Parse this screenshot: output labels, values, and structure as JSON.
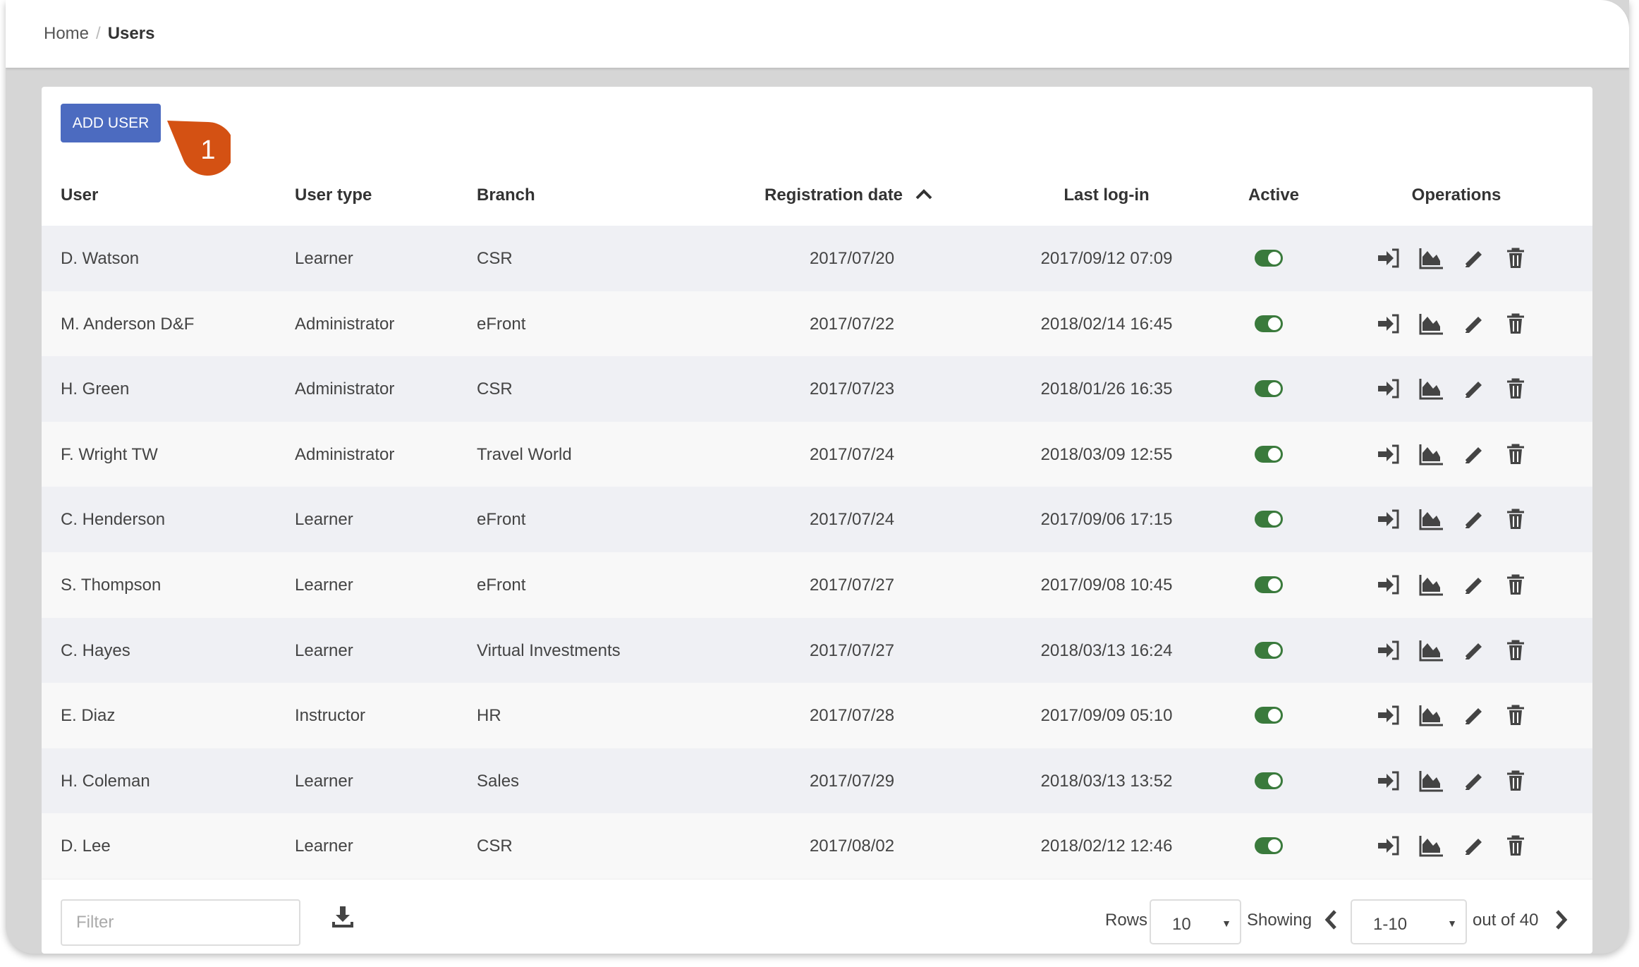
{
  "breadcrumb": {
    "home": "Home",
    "separator": "/",
    "current": "Users"
  },
  "toolbar": {
    "add_user": "ADD USER",
    "callout_number": "1"
  },
  "colors": {
    "accent": "#4c6bc0",
    "callout": "#d45113",
    "toggle_on": "#3a7a3c"
  },
  "table": {
    "headers": {
      "user": "User",
      "user_type": "User type",
      "branch": "Branch",
      "registration_date": "Registration date",
      "last_login": "Last log-in",
      "active": "Active",
      "operations": "Operations"
    },
    "sort": {
      "column": "registration_date",
      "direction": "ascending"
    },
    "rows": [
      {
        "user": "D. Watson",
        "type": "Learner",
        "branch": "CSR",
        "reg": "2017/07/20",
        "login": "2017/09/12 07:09",
        "active": true
      },
      {
        "user": "M. Anderson D&F",
        "type": "Administrator",
        "branch": "eFront",
        "reg": "2017/07/22",
        "login": "2018/02/14 16:45",
        "active": true
      },
      {
        "user": "H. Green",
        "type": "Administrator",
        "branch": "CSR",
        "reg": "2017/07/23",
        "login": "2018/01/26 16:35",
        "active": true
      },
      {
        "user": "F. Wright TW",
        "type": "Administrator",
        "branch": "Travel World",
        "reg": "2017/07/24",
        "login": "2018/03/09 12:55",
        "active": true
      },
      {
        "user": "C. Henderson",
        "type": "Learner",
        "branch": "eFront",
        "reg": "2017/07/24",
        "login": "2017/09/06 17:15",
        "active": true
      },
      {
        "user": "S. Thompson",
        "type": "Learner",
        "branch": "eFront",
        "reg": "2017/07/27",
        "login": "2017/09/08 10:45",
        "active": true
      },
      {
        "user": "C. Hayes",
        "type": "Learner",
        "branch": "Virtual Investments",
        "reg": "2017/07/27",
        "login": "2018/03/13 16:24",
        "active": true
      },
      {
        "user": "E. Diaz",
        "type": "Instructor",
        "branch": "HR",
        "reg": "2017/07/28",
        "login": "2017/09/09 05:10",
        "active": true
      },
      {
        "user": "H. Coleman",
        "type": "Learner",
        "branch": "Sales",
        "reg": "2017/07/29",
        "login": "2018/03/13 13:52",
        "active": true
      },
      {
        "user": "D. Lee",
        "type": "Learner",
        "branch": "CSR",
        "reg": "2017/08/02",
        "login": "2018/02/12 12:46",
        "active": true
      }
    ],
    "operation_icons": [
      "login-icon",
      "chart-area-icon",
      "pencil-icon",
      "trash-icon"
    ]
  },
  "footer": {
    "filter_placeholder": "Filter",
    "rows_label": "Rows",
    "rows_value": "10",
    "showing_label": "Showing",
    "range_value": "1-10",
    "out_of": "out of 40"
  }
}
